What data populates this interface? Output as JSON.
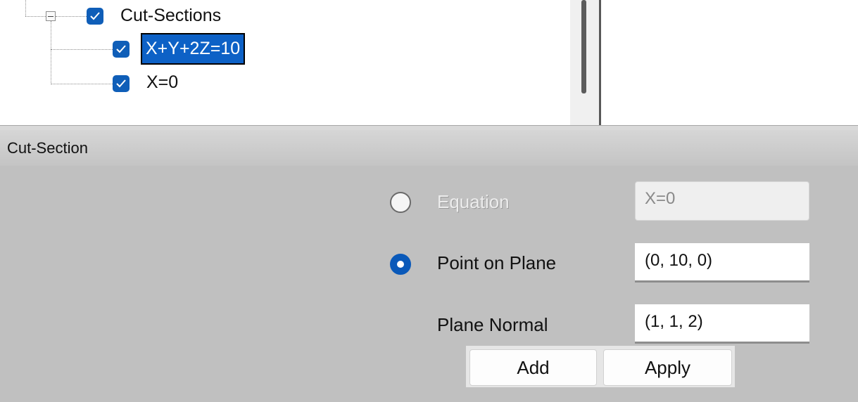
{
  "tree": {
    "root": {
      "label": "Cut-Sections",
      "checked": true,
      "expanded": true
    },
    "children": [
      {
        "label": "X+Y+2Z=10",
        "checked": true,
        "selected": true
      },
      {
        "label": "X=0",
        "checked": true,
        "selected": false
      }
    ]
  },
  "panel": {
    "title": "Cut-Section",
    "options": {
      "equation": {
        "label": "Equation",
        "value": "X=0",
        "selected": false,
        "enabled": false
      },
      "point_on_plane": {
        "label": "Point on Plane",
        "value": "(0, 10, 0)",
        "selected": true
      },
      "plane_normal": {
        "label": "Plane Normal",
        "value": "(1, 1, 2)"
      }
    },
    "buttons": {
      "add": "Add",
      "apply": "Apply"
    }
  },
  "colors": {
    "accent": "#0f5eb8",
    "selection": "#0d61c6",
    "panel_bg": "#c0c0c0"
  }
}
